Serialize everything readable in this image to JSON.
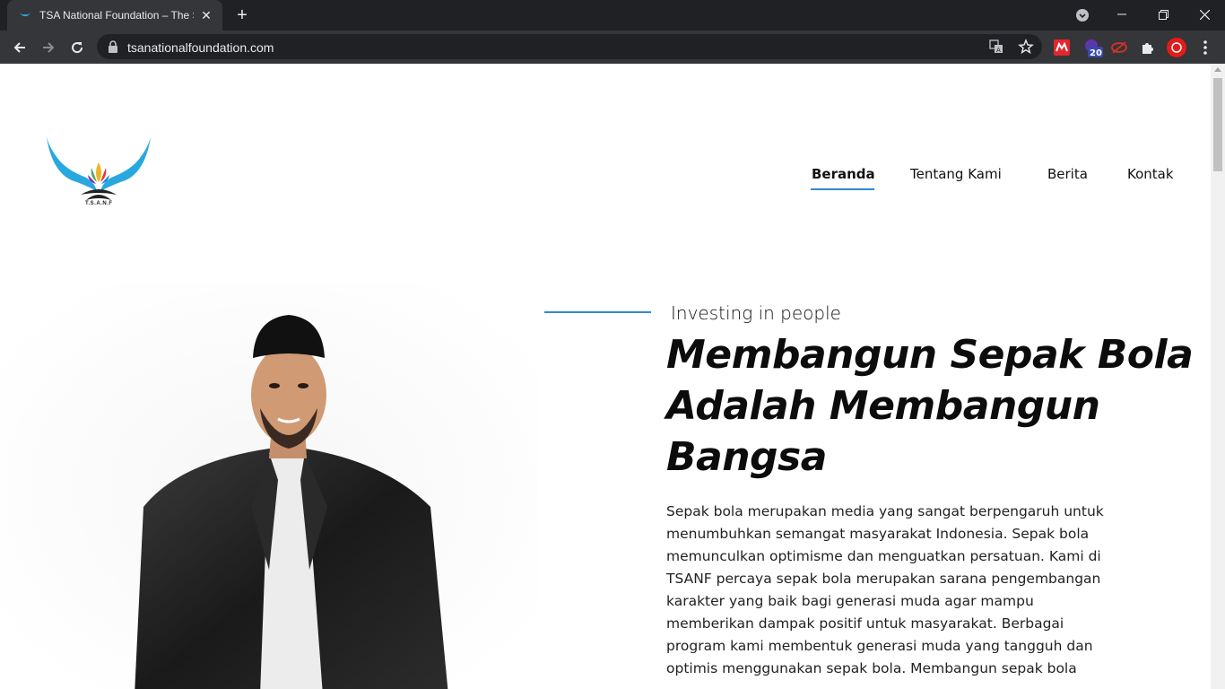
{
  "browser": {
    "tab_title": "TSA National Foundation – The S",
    "url": "tsanationalfoundation.com",
    "extension_badge": "20"
  },
  "site": {
    "logo_text": "T.S.A.N.F",
    "nav": [
      {
        "label": "Beranda",
        "active": true
      },
      {
        "label": "Tentang Kami",
        "active": false
      },
      {
        "label": "Berita",
        "active": false
      },
      {
        "label": "Kontak",
        "active": false
      }
    ]
  },
  "hero": {
    "kicker": "Investing in people",
    "headline": [
      "Membangun Sepak Bola",
      "Adalah Membangun",
      "Bangsa"
    ],
    "body": [
      "Sepak bola merupakan media yang sangat berpengaruh untuk",
      "menumbuhkan semangat masyarakat Indonesia. Sepak bola",
      "memunculkan optimisme dan menguatkan persatuan. Kami di",
      "TSANF percaya sepak bola merupakan sarana pengembangan",
      "karakter yang baik bagi generasi muda agar mampu",
      "memberikan dampak positif untuk masyarakat. Berbagai",
      "program kami membentuk generasi muda yang tangguh dan",
      "optimis menggunakan sepak bola. Membangun sepak bola"
    ]
  },
  "colors": {
    "accent": "#2e8bd1",
    "chrome_dark": "#202124",
    "chrome_toolbar": "#35363a"
  }
}
